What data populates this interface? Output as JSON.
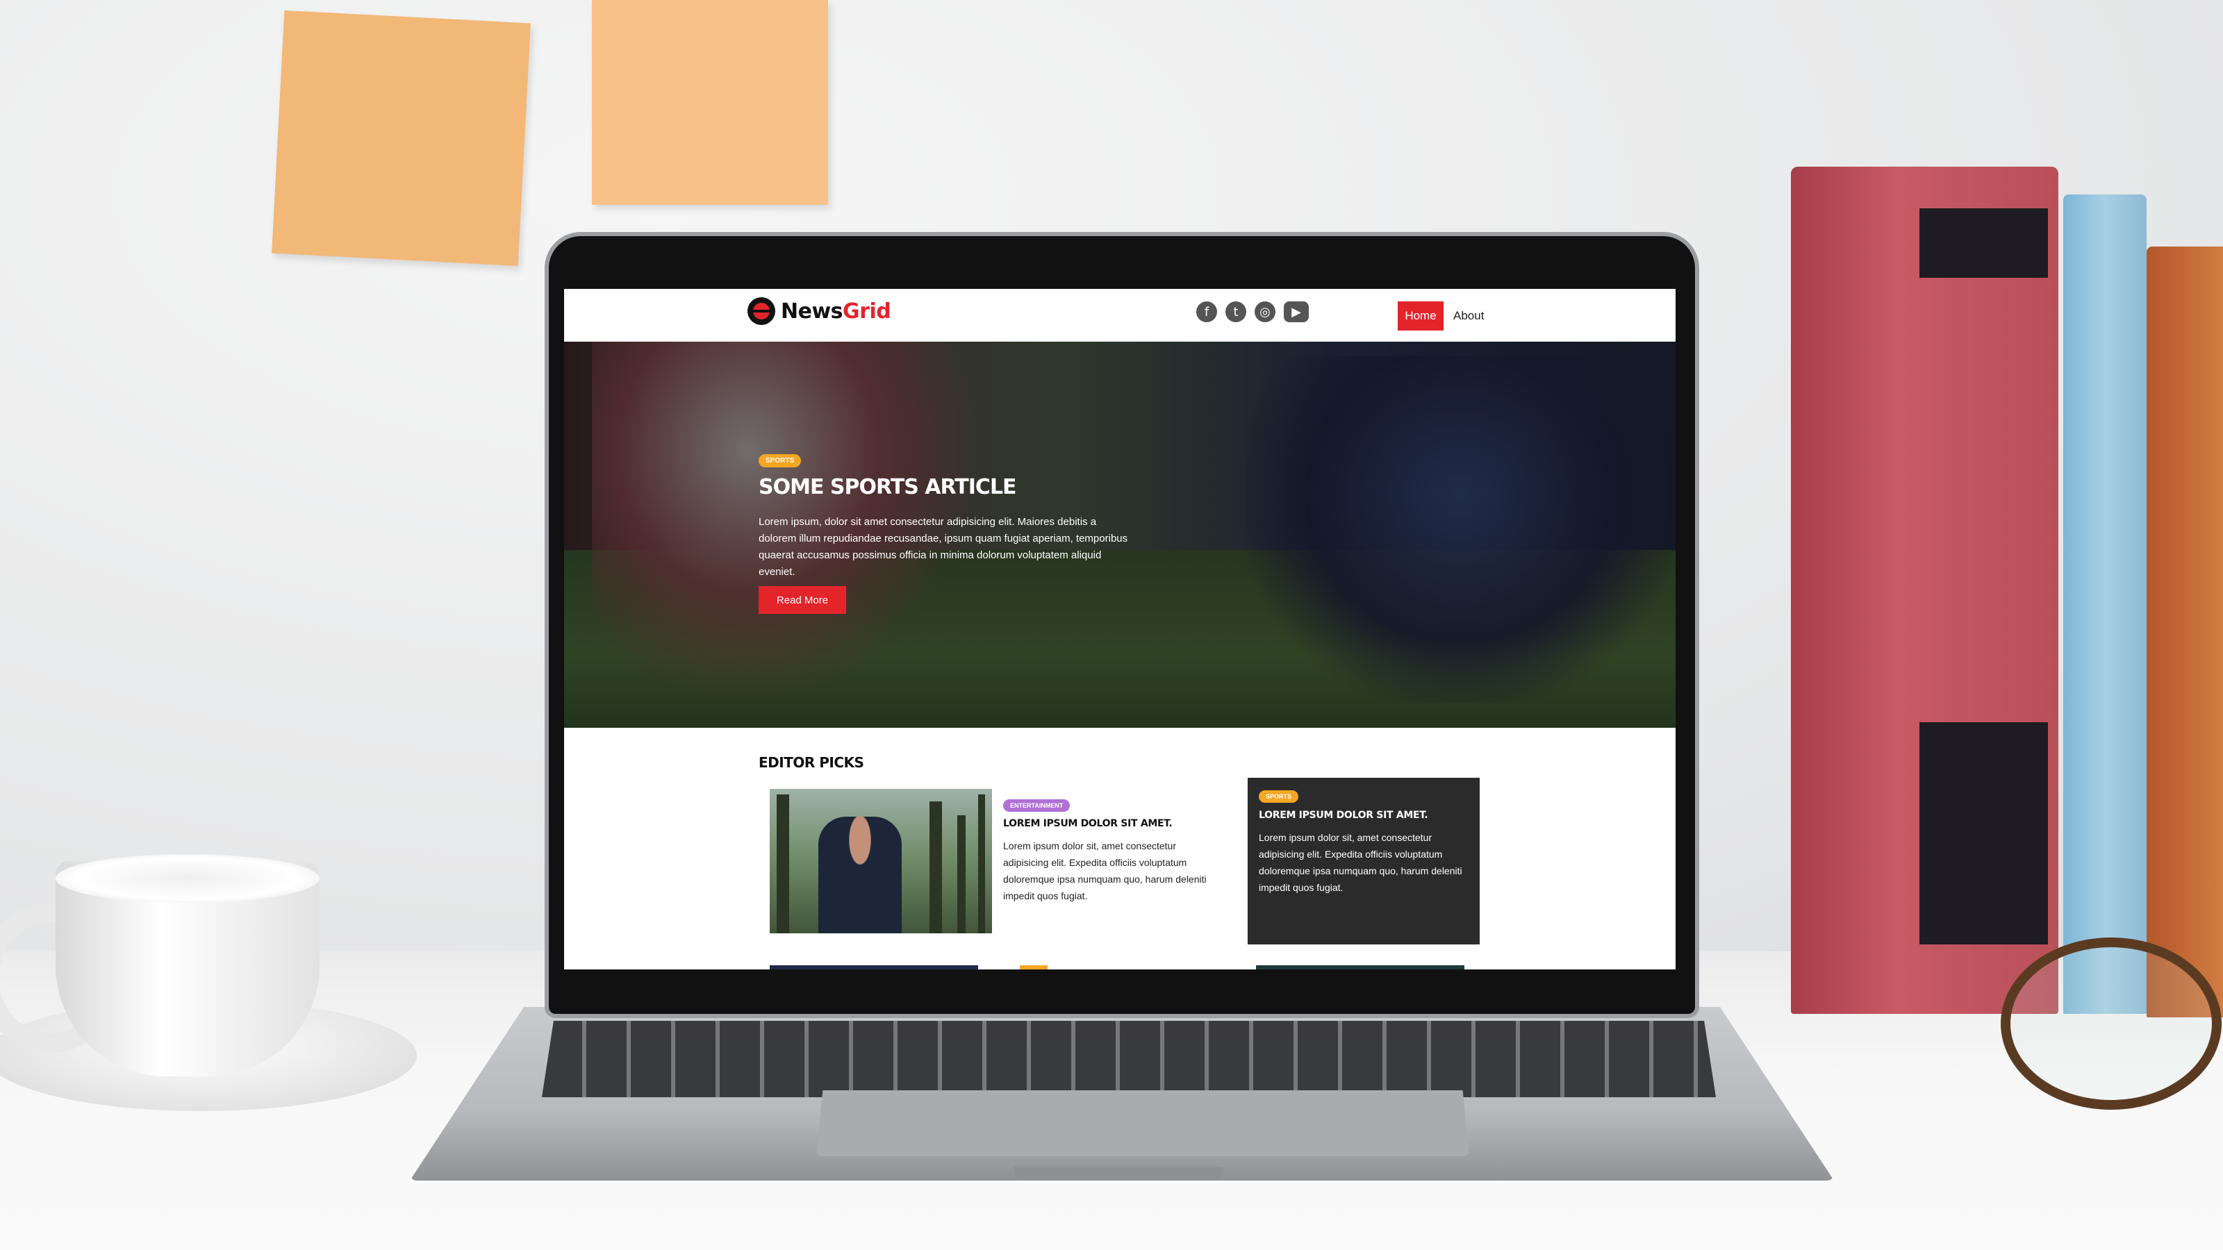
{
  "site": {
    "logo_news": "News",
    "logo_grid": "Grid",
    "brand_color": "#e3242b"
  },
  "social": {
    "icons": [
      "facebook-icon",
      "twitter-icon",
      "instagram-icon",
      "youtube-icon"
    ],
    "facebook_glyph": "f",
    "twitter_glyph": "t",
    "instagram_glyph": "◎",
    "youtube_glyph": "▶"
  },
  "nav": {
    "home": "Home",
    "about": "About"
  },
  "hero": {
    "badge": "SPORTS",
    "badge_color": "#f5a623",
    "title": "Some Sports Article",
    "text": "Lorem ipsum, dolor sit amet consectetur adipisicing elit. Maiores debitis a dolorem illum repudiandae recusandae, ipsum quam fugiat aperiam, temporibus quaerat accusamus possimus officia in minima dolorum voluptatem aliquid eveniet.",
    "button": "Read More"
  },
  "editor_picks": {
    "title": "Editor Picks",
    "items": [
      {
        "badge": "ENTERTAINMENT",
        "badge_color": "#b070d6",
        "title": "Lorem ipsum dolor sit amet.",
        "text": "Lorem ipsum dolor sit, amet consectetur adipisicing elit. Expedita officiis voluptatum doloremque ipsa numquam quo, harum deleniti impedit quos fugiat."
      },
      {
        "badge": "SPORTS",
        "badge_color": "#f5a623",
        "title": "Lorem ipsum dolor sit amet.",
        "text": "Lorem ipsum dolor sit, amet consectetur adipisicing elit. Expedita officiis voluptatum doloremque ipsa numquam quo, harum deleniti impedit quos fugiat."
      }
    ]
  }
}
